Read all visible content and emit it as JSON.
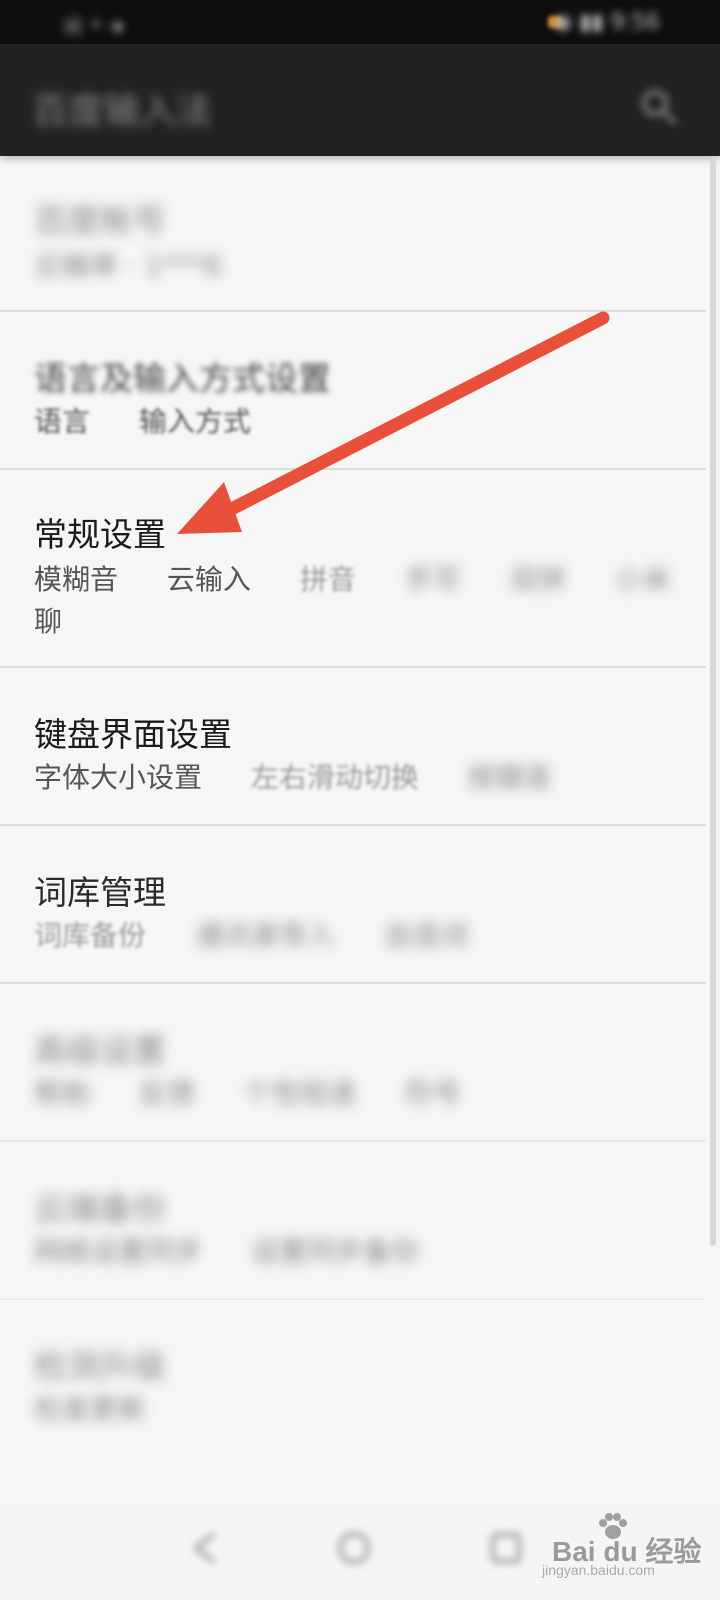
{
  "status_bar": {
    "left": "Ⓗ ᴳ ✈",
    "right": "◉ ▮▮ 9:56"
  },
  "app_bar": {
    "title": "百度输入法",
    "search_icon": "search-icon"
  },
  "items": [
    {
      "title": "百度帐号",
      "subs": [
        "云输单 · 1***6"
      ]
    },
    {
      "title": "语言及输入方式设置",
      "subs": [
        "语言",
        "输入方式"
      ]
    },
    {
      "title": "常规设置",
      "subs": [
        "模糊音",
        "云输入",
        "拼音",
        "手写",
        "双拼",
        "小米",
        "聊"
      ]
    },
    {
      "title": "键盘界面设置",
      "subs": [
        "字体大小设置",
        "左右滑动切换",
        "按键音"
      ]
    },
    {
      "title": "词库管理",
      "subs": [
        "词库备份",
        "通讯录导入",
        "自造词"
      ]
    },
    {
      "title": "高级设置",
      "subs": [
        "帮助",
        "反馈",
        "个性短语",
        "符号"
      ]
    },
    {
      "title": "云端备份",
      "subs": [
        "网络设置同步",
        "设置同步备份"
      ]
    },
    {
      "title": "检测升级",
      "subs": [
        "检查更新"
      ]
    }
  ],
  "nav": {
    "back_icon": "back-icon",
    "home_icon": "home-icon",
    "recent_icon": "recent-apps-icon"
  },
  "watermark": {
    "brand": "Bai du 经验",
    "url": "jingyan.baidu.com"
  },
  "colors": {
    "arrow": "#e8503a",
    "app_bar": "#222222",
    "background": "#f6f6f6"
  }
}
